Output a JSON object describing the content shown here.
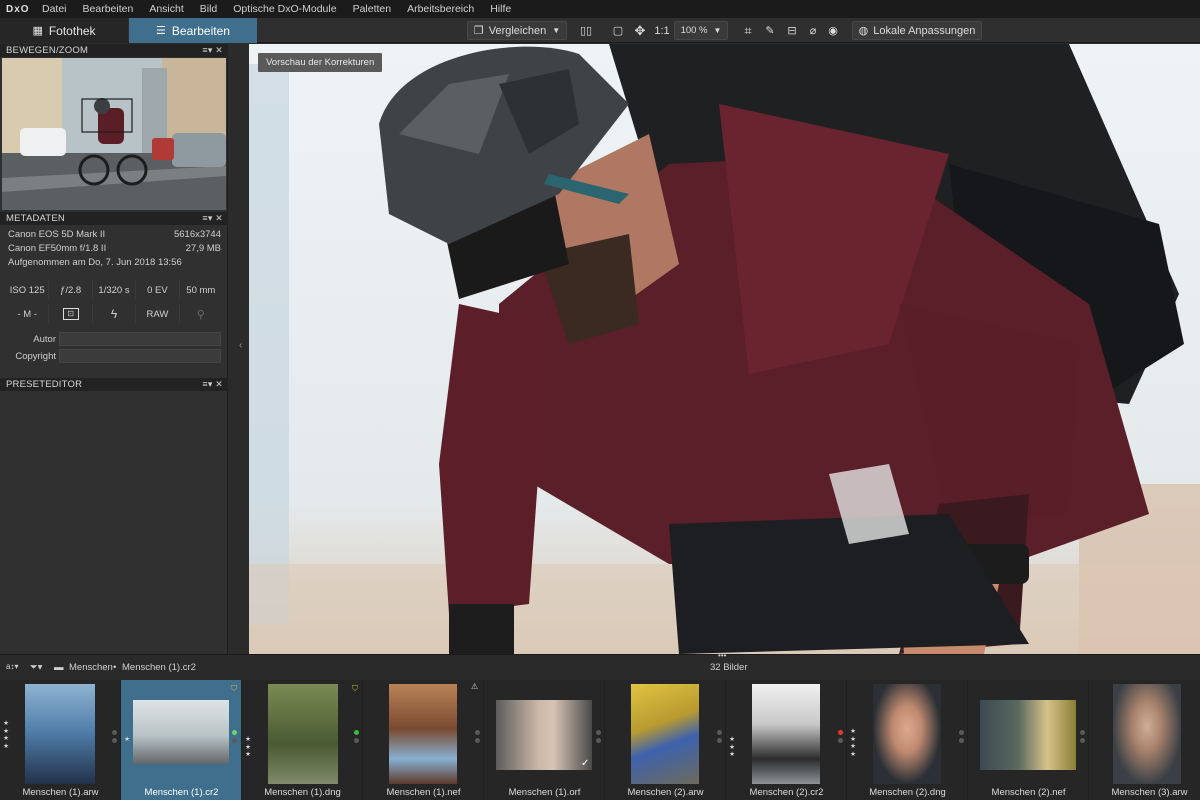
{
  "app": {
    "logo": "DxO"
  },
  "menu": [
    "Datei",
    "Bearbeiten",
    "Ansicht",
    "Bild",
    "Optische DxO-Module",
    "Paletten",
    "Arbeitsbereich",
    "Hilfe"
  ],
  "tabs": {
    "library": "Fotothek",
    "edit": "Bearbeiten"
  },
  "toolbar": {
    "compare": "Vergleichen",
    "zoom_1to1": "1:1",
    "zoom_value": "100 %",
    "local_adjust": "Lokale Anpassungen"
  },
  "panels": {
    "navigator": "BEWEGEN/ZOOM",
    "metadata": "METADATEN",
    "preset": "PRESETEDITOR",
    "controls": "≡▾ ✕"
  },
  "metadata": {
    "camera": "Canon EOS 5D Mark II",
    "resolution": "5616x3744",
    "lens": "Canon EF50mm f/1.8 II",
    "filesize": "27,9 MB",
    "captured": "Aufgenommen am Do, 7. Jun 2018 13:56",
    "iso": "ISO 125",
    "aperture": "ƒ/2.8",
    "shutter": "1/320 s",
    "ev": "0 EV",
    "focal": "50 mm",
    "mode": "- M -",
    "format": "RAW",
    "author_label": "Autor",
    "author_value": "",
    "copyright_label": "Copyright",
    "copyright_value": ""
  },
  "viewer": {
    "preview_label": "Vorschau der Korrekturen"
  },
  "filmstrip": {
    "path_folder": "Menschen",
    "path_sep": "•",
    "path_file": "Menschen (1).cr2",
    "count": "32 Bilder",
    "sort_icon": "a-z-sort-icon",
    "items": [
      {
        "name": "Menschen (1).arw",
        "stars": 4,
        "colors": [
          "#7ea5c6",
          "#2a4e78",
          "#1a1f2a"
        ]
      },
      {
        "name": "Menschen (1).cr2",
        "stars": 1,
        "selected": true,
        "colors": [
          "#d7dcdc",
          "#8b9a9f",
          "#5f5f5f"
        ]
      },
      {
        "name": "Menschen (1).dng",
        "stars": 3,
        "colors": [
          "#6a7a48",
          "#3e4a2a",
          "#9aa68a"
        ]
      },
      {
        "name": "Menschen (1).nef",
        "stars": 0,
        "colors": [
          "#b57b52",
          "#6e3e28",
          "#8db4d8"
        ]
      },
      {
        "name": "Menschen (1).orf",
        "stars": 0,
        "colors": [
          "#6a6b68",
          "#c7b5a5",
          "#3b3b3b"
        ]
      },
      {
        "name": "Menschen (2).arw",
        "stars": 0,
        "colors": [
          "#c5a83b",
          "#3a5fa8",
          "#6e6a5a"
        ]
      },
      {
        "name": "Menschen (2).cr2",
        "stars": 3,
        "colors": [
          "#e8e8e8",
          "#2a2a2a",
          "#9aa0a4"
        ]
      },
      {
        "name": "Menschen (2).dng",
        "stars": 4,
        "colors": [
          "#2b3138",
          "#d9a48c",
          "#a8443a"
        ]
      },
      {
        "name": "Menschen (2).nef",
        "stars": 0,
        "colors": [
          "#8a7e36",
          "#3a4a52",
          "#d6c28a"
        ]
      },
      {
        "name": "Menschen (3).arw",
        "stars": 0,
        "colors": [
          "#3b4248",
          "#c7a48e",
          "#6a5a50"
        ]
      }
    ]
  }
}
